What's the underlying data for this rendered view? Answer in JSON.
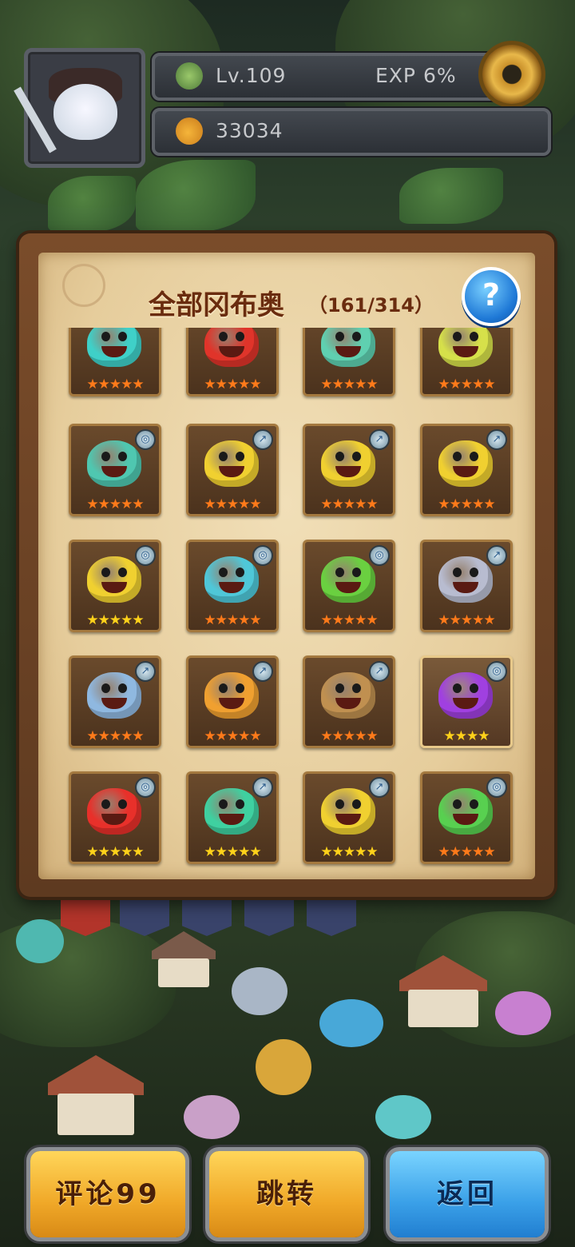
{
  "hud": {
    "level": "Lv.109",
    "exp": "EXP   6%",
    "gold": "33034"
  },
  "panel": {
    "title": "全部冈布奥",
    "count": "（161/314）",
    "help_label": "?"
  },
  "pets": [
    {
      "color": "#3fd0c8",
      "stars": 5,
      "star_color": "#ff7a1a",
      "elem": ""
    },
    {
      "color": "#e0342a",
      "stars": 5,
      "star_color": "#ff7a1a",
      "elem": ""
    },
    {
      "color": "#5fd0b0",
      "stars": 5,
      "star_color": "#ff7a1a",
      "elem": ""
    },
    {
      "color": "#d6e04a",
      "stars": 5,
      "star_color": "#ff7a1a",
      "elem": ""
    },
    {
      "color": "#4fc7b0",
      "stars": 5,
      "star_color": "#ff7a1a",
      "elem": "◎"
    },
    {
      "color": "#f0d030",
      "stars": 5,
      "star_color": "#ff7a1a",
      "elem": "↗"
    },
    {
      "color": "#f0d030",
      "stars": 5,
      "star_color": "#ff7a1a",
      "elem": "↗"
    },
    {
      "color": "#f0d030",
      "stars": 5,
      "star_color": "#ff7a1a",
      "elem": "↗"
    },
    {
      "color": "#f0d030",
      "stars": 5,
      "star_color": "#ffd21a",
      "elem": "◎"
    },
    {
      "color": "#4fc7d8",
      "stars": 5,
      "star_color": "#ff7a1a",
      "elem": "◎"
    },
    {
      "color": "#6ad040",
      "stars": 5,
      "star_color": "#ff7a1a",
      "elem": "◎"
    },
    {
      "color": "#b8bcd0",
      "stars": 5,
      "star_color": "#ff7a1a",
      "elem": "↗"
    },
    {
      "color": "#8fb8e0",
      "stars": 5,
      "star_color": "#ff7a1a",
      "elem": "↗"
    },
    {
      "color": "#f0a030",
      "stars": 5,
      "star_color": "#ff7a1a",
      "elem": "↗"
    },
    {
      "color": "#c09050",
      "stars": 5,
      "star_color": "#ff7a1a",
      "elem": "↗"
    },
    {
      "color": "#a040e0",
      "stars": 4,
      "star_color": "#ffd21a",
      "elem": "◎"
    },
    {
      "color": "#e8302a",
      "stars": 5,
      "star_color": "#ffd21a",
      "elem": "◎"
    },
    {
      "color": "#3fd0a0",
      "stars": 5,
      "star_color": "#ffd21a",
      "elem": "↗"
    },
    {
      "color": "#f0d030",
      "stars": 5,
      "star_color": "#ffd21a",
      "elem": "↗"
    },
    {
      "color": "#58d050",
      "stars": 5,
      "star_color": "#ff7a1a",
      "elem": "◎"
    }
  ],
  "buttons": {
    "comment": "评论99",
    "jump": "跳转",
    "back": "返回"
  }
}
